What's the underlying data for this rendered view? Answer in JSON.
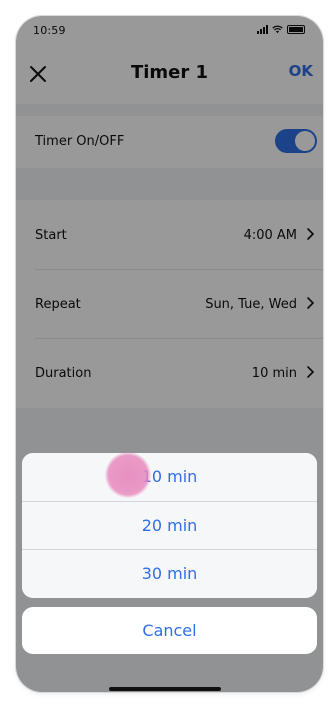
{
  "status_bar": {
    "time": "10:59"
  },
  "nav": {
    "title": "Timer 1",
    "ok_label": "OK"
  },
  "settings": {
    "timer_toggle": {
      "label": "Timer On/OFF",
      "on": true
    },
    "rows": [
      {
        "label": "Start",
        "value": "4:00 AM"
      },
      {
        "label": "Repeat",
        "value": "Sun, Tue, Wed"
      },
      {
        "label": "Duration",
        "value": "10 min"
      }
    ]
  },
  "duration_sheet": {
    "options": [
      "10 min",
      "20 min",
      "30 min"
    ],
    "cancel_label": "Cancel"
  },
  "colors": {
    "accent": "#2f6ee6",
    "touch_indicator": "#e78abe"
  },
  "icons": {
    "close": "close-icon",
    "chevron": "chevron-right-icon"
  }
}
